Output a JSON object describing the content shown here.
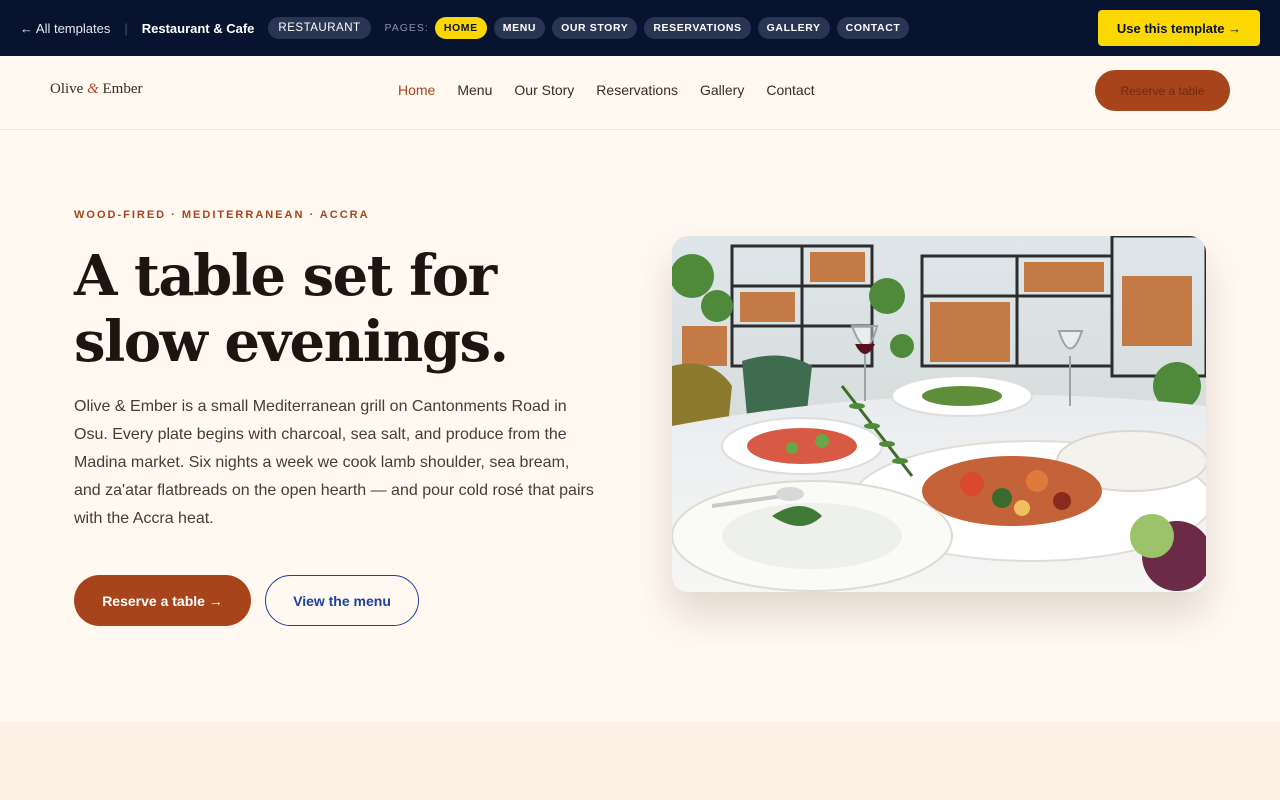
{
  "topbar": {
    "back_label": "← All templates",
    "divider": "|",
    "template_name": "Restaurant & Cafe",
    "category": "RESTAURANT",
    "pages_label": "PAGES:",
    "pages": [
      "HOME",
      "MENU",
      "OUR STORY",
      "RESERVATIONS",
      "GALLERY",
      "CONTACT"
    ],
    "active_page": "HOME",
    "use_template_label": "Use this template →",
    "accent_color": "#fdd800",
    "background_color": "#081330"
  },
  "site": {
    "logo": {
      "first": "Olive",
      "amp": "&",
      "last": "Ember"
    },
    "nav": [
      "Home",
      "Menu",
      "Our Story",
      "Reservations",
      "Gallery",
      "Contact"
    ],
    "active_nav": "Home",
    "header_cta": "Reserve a table",
    "brand_color": "#a8441c"
  },
  "hero": {
    "eyebrow": "WOOD-FIRED · MEDITERRANEAN · ACCRA",
    "headline_line1": "A table set for",
    "headline_line2": "slow evenings.",
    "body": "Olive & Ember is a small Mediterranean grill on Cantonments Road in Osu. Every plate begins with charcoal, sea salt, and produce from the Madina market. Six nights a week we cook lamb shoulder, sea bream, and za'atar flatbreads on the open hearth — and pour cold rosé that pairs with the Accra heat.",
    "primary_cta": "Reserve a table →",
    "secondary_cta": "View the menu",
    "secondary_color": "#1d3f9e"
  }
}
